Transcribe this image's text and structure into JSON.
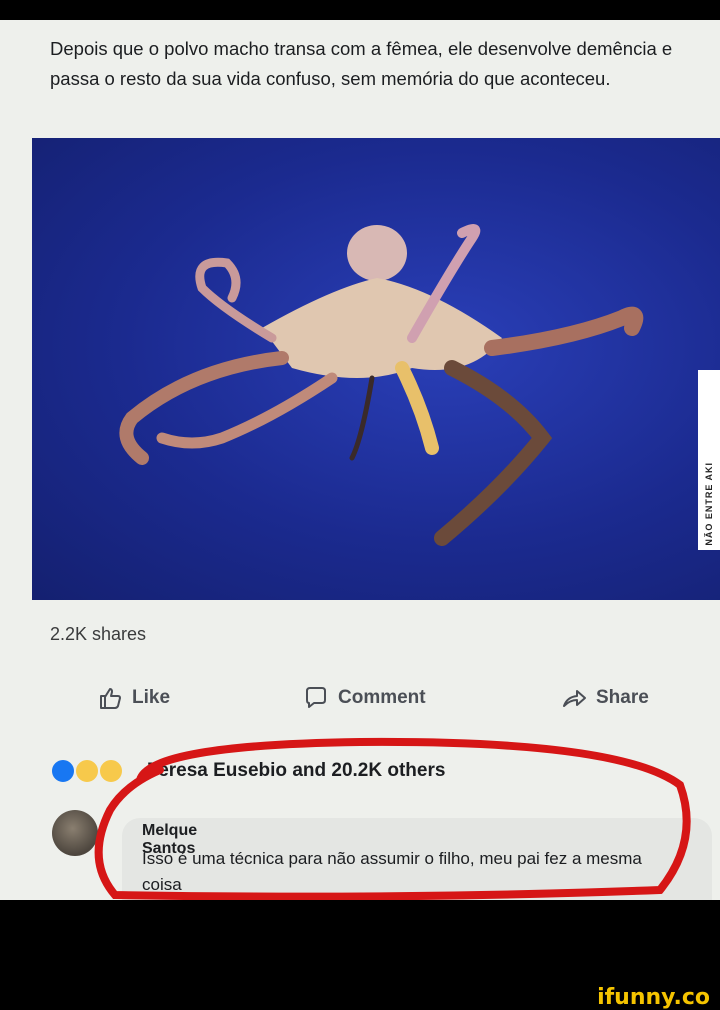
{
  "post": {
    "caption": "Depois que o polvo macho transa com a fêmea, ele desenvolve demência e passa o resto da sua vida confuso, sem memória do que aconteceu.",
    "photo_subject": "octopus-photo",
    "photo_watermark": "NÃO ENTRE AKI",
    "shares": "2.2K shares"
  },
  "actions": {
    "like_label": "Like",
    "comment_label": "Comment",
    "share_label": "Share"
  },
  "reactions": {
    "text": "Teresa Eusebio and 20.2K others",
    "colors": {
      "like": "#1877f2",
      "haha": "#f7c94b",
      "wow": "#f7c94b"
    }
  },
  "comment": {
    "author": "Melque Santos",
    "text": "Isso é uma técnica para não assumir o filho, meu pai fez a mesma coisa"
  },
  "annotation": {
    "color": "#d61616"
  },
  "branding": {
    "logo": "ifunny.co"
  }
}
